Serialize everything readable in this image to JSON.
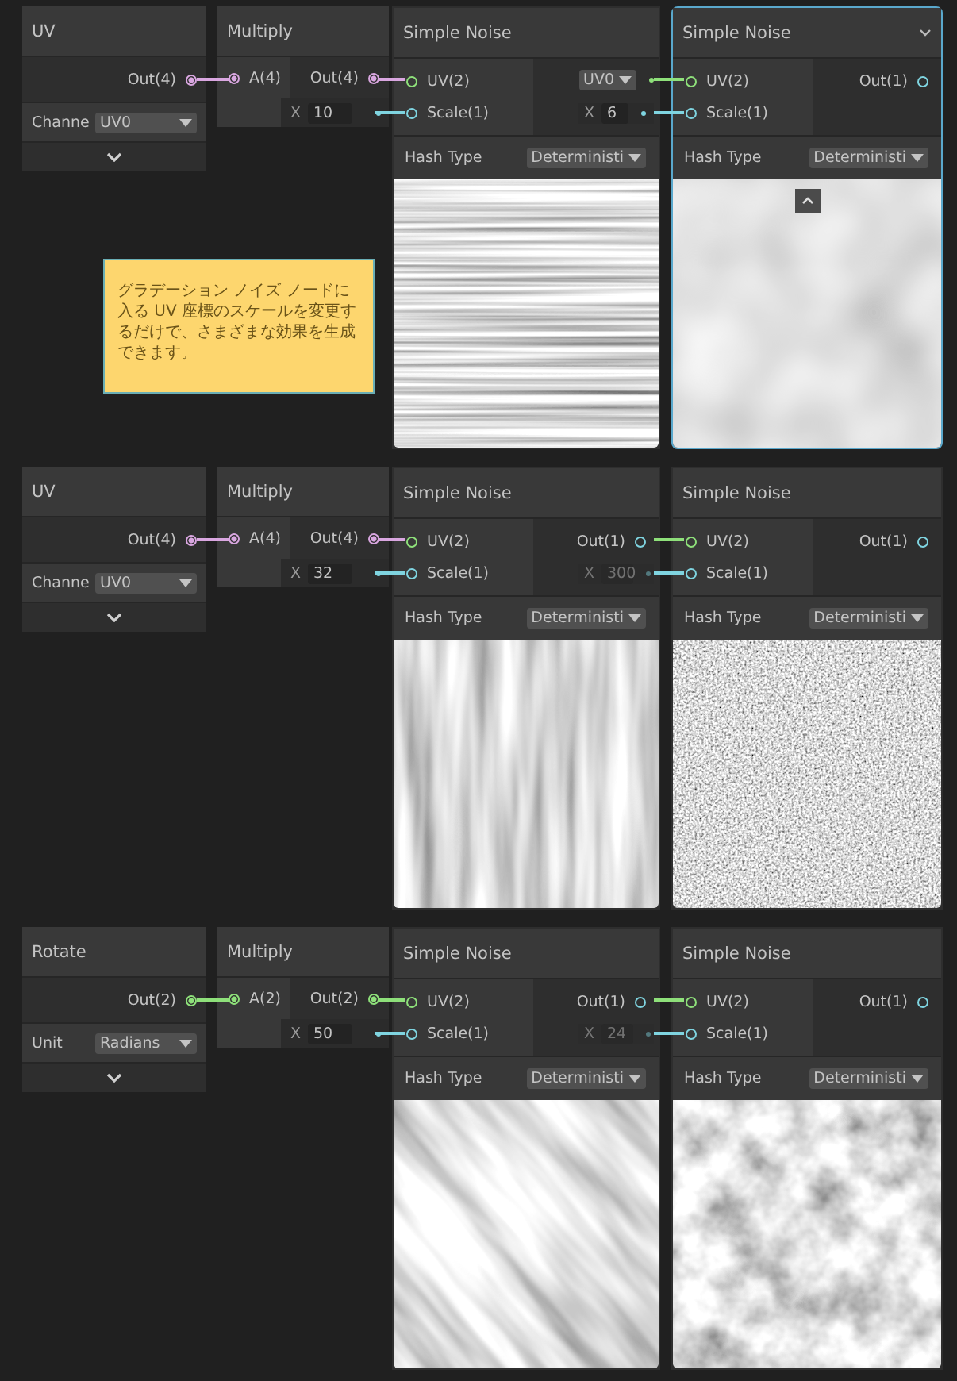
{
  "rows": [
    {
      "source": {
        "title": "UV",
        "output": {
          "label": "Out(4)",
          "color": "#d9a6e0"
        },
        "control": {
          "label": "Channe",
          "value": "UV0"
        }
      },
      "multiply": {
        "title": "Multiply",
        "input": {
          "label": "A(4)",
          "color": "#d9a6e0"
        },
        "output": {
          "label": "Out(4)",
          "color": "#d9a6e0"
        },
        "factor": {
          "axis": "X",
          "value": "10"
        }
      },
      "noises": [
        {
          "title": "Simple Noise",
          "selected": false,
          "header_chevron": false,
          "inputs": [
            {
              "label": "UV(2)",
              "color": "#8ee07a"
            },
            {
              "label": "Scale(1)",
              "color": "#7fd4e0"
            }
          ],
          "hash_label": "Hash Type",
          "hash_value": "Deterministi",
          "preview": {
            "kind": "horizontal-streaks"
          },
          "collapse_button": false
        },
        {
          "title": "Simple Noise",
          "selected": true,
          "header_chevron": true,
          "inline": {
            "faded": false,
            "uv": "UV0",
            "axis": "X",
            "scale": "6"
          },
          "inputs": [
            {
              "label": "UV(2)",
              "color": "#8ee07a"
            },
            {
              "label": "Scale(1)",
              "color": "#7fd4e0"
            }
          ],
          "output": {
            "label": "Out(1)",
            "color": "#7fd4e0"
          },
          "hash_label": "Hash Type",
          "hash_value": "Deterministi",
          "preview": {
            "kind": "soft-blobs"
          },
          "collapse_button": true
        }
      ]
    },
    {
      "source": {
        "title": "UV",
        "output": {
          "label": "Out(4)",
          "color": "#d9a6e0"
        },
        "control": {
          "label": "Channe",
          "value": "UV0"
        }
      },
      "multiply": {
        "title": "Multiply",
        "input": {
          "label": "A(4)",
          "color": "#d9a6e0"
        },
        "output": {
          "label": "Out(4)",
          "color": "#d9a6e0"
        },
        "factor": {
          "axis": "X",
          "value": "32"
        }
      },
      "noises": [
        {
          "title": "Simple Noise",
          "selected": false,
          "header_chevron": false,
          "inputs": [
            {
              "label": "UV(2)",
              "color": "#8ee07a"
            },
            {
              "label": "Scale(1)",
              "color": "#7fd4e0"
            }
          ],
          "output": {
            "label": "Out(1)",
            "color": "#7fd4e0"
          },
          "hash_label": "Hash Type",
          "hash_value": "Deterministi",
          "preview": {
            "kind": "vertical-streaks"
          },
          "collapse_button": false
        },
        {
          "title": "Simple Noise",
          "selected": false,
          "header_chevron": false,
          "inline": {
            "faded": true,
            "axis": "X",
            "scale": "300"
          },
          "inputs": [
            {
              "label": "UV(2)",
              "color": "#8ee07a"
            },
            {
              "label": "Scale(1)",
              "color": "#7fd4e0"
            }
          ],
          "output": {
            "label": "Out(1)",
            "color": "#7fd4e0"
          },
          "hash_label": "Hash Type",
          "hash_value": "Deterministi",
          "preview": {
            "kind": "fine-grain"
          },
          "collapse_button": false
        }
      ]
    },
    {
      "source": {
        "title": "Rotate",
        "output": {
          "label": "Out(2)",
          "color": "#8ee07a"
        },
        "control": {
          "label": "Unit",
          "value": "Radians"
        }
      },
      "multiply": {
        "title": "Multiply",
        "input": {
          "label": "A(2)",
          "color": "#8ee07a"
        },
        "output": {
          "label": "Out(2)",
          "color": "#8ee07a"
        },
        "factor": {
          "axis": "X",
          "value": "50"
        }
      },
      "noises": [
        {
          "title": "Simple Noise",
          "selected": false,
          "header_chevron": false,
          "inputs": [
            {
              "label": "UV(2)",
              "color": "#8ee07a"
            },
            {
              "label": "Scale(1)",
              "color": "#7fd4e0"
            }
          ],
          "output": {
            "label": "Out(1)",
            "color": "#7fd4e0"
          },
          "hash_label": "Hash Type",
          "hash_value": "Deterministi",
          "preview": {
            "kind": "diagonal-streaks"
          },
          "collapse_button": false
        },
        {
          "title": "Simple Noise",
          "selected": false,
          "header_chevron": false,
          "inline": {
            "faded": true,
            "axis": "X",
            "scale": "24"
          },
          "inputs": [
            {
              "label": "UV(2)",
              "color": "#8ee07a"
            },
            {
              "label": "Scale(1)",
              "color": "#7fd4e0"
            }
          ],
          "output": {
            "label": "Out(1)",
            "color": "#7fd4e0"
          },
          "hash_label": "Hash Type",
          "hash_value": "Deterministi",
          "preview": {
            "kind": "clouds"
          },
          "collapse_button": false
        }
      ]
    }
  ],
  "note": {
    "text": "グラデーション ノイズ ノードに入る UV 座標のスケールを変更するだけで、さまざまな効果を生成できます。"
  }
}
